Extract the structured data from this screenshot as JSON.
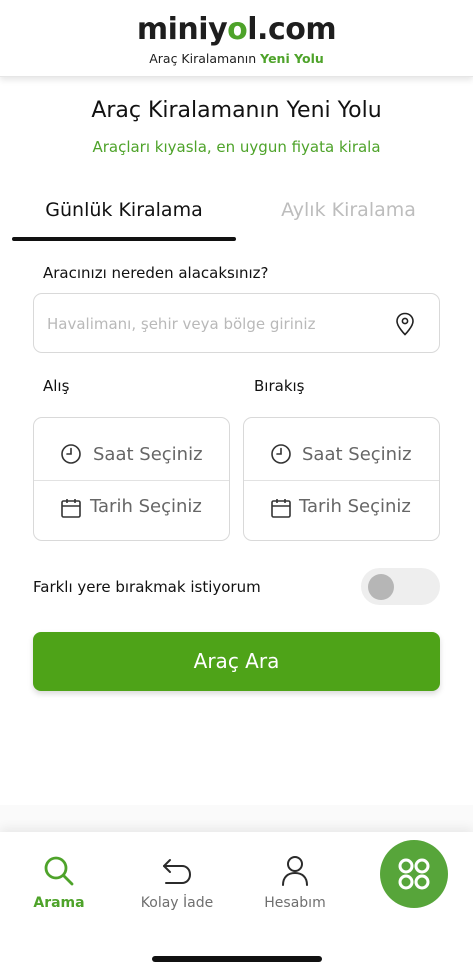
{
  "brand": {
    "logo_prefix": "miniy",
    "logo_accent": "o",
    "logo_suffix": "l.com",
    "tagline_prefix": "Araç Kiralamanın",
    "tagline_highlight": "Yeni Yolu",
    "accent_color": "#4ea32a"
  },
  "hero": {
    "title": "Araç Kiralamanın Yeni Yolu",
    "subtitle": "Araçları kıyasla, en uygun fiyata kirala"
  },
  "tabs": [
    {
      "label": "Günlük Kiralama",
      "active": true
    },
    {
      "label": "Aylık Kiralama",
      "active": false
    }
  ],
  "form": {
    "location_label": "Aracınızı nereden alacaksınız?",
    "location_placeholder": "Havalimanı, şehir veya bölge giriniz",
    "location_icon": "location-pin-icon",
    "pickup": {
      "label": "Alış",
      "time_placeholder": "Saat Seçiniz",
      "date_placeholder": "Tarih Seçiniz"
    },
    "dropoff": {
      "label": "Bırakış",
      "time_placeholder": "Saat Seçiniz",
      "date_placeholder": "Tarih Seçiniz"
    },
    "different_dropoff_label": "Farklı yere bırakmak istiyorum",
    "different_dropoff_enabled": false,
    "submit_label": "Araç Ara",
    "submit_color": "#4ea318"
  },
  "bottom_nav": [
    {
      "label": "Arama",
      "icon": "search-icon",
      "active": true
    },
    {
      "label": "Kolay İade",
      "icon": "undo-arrow-icon",
      "active": false
    },
    {
      "label": "Hesabım",
      "icon": "user-icon",
      "active": false
    },
    {
      "label": "",
      "icon": "grid-circles-icon",
      "active": false
    }
  ]
}
